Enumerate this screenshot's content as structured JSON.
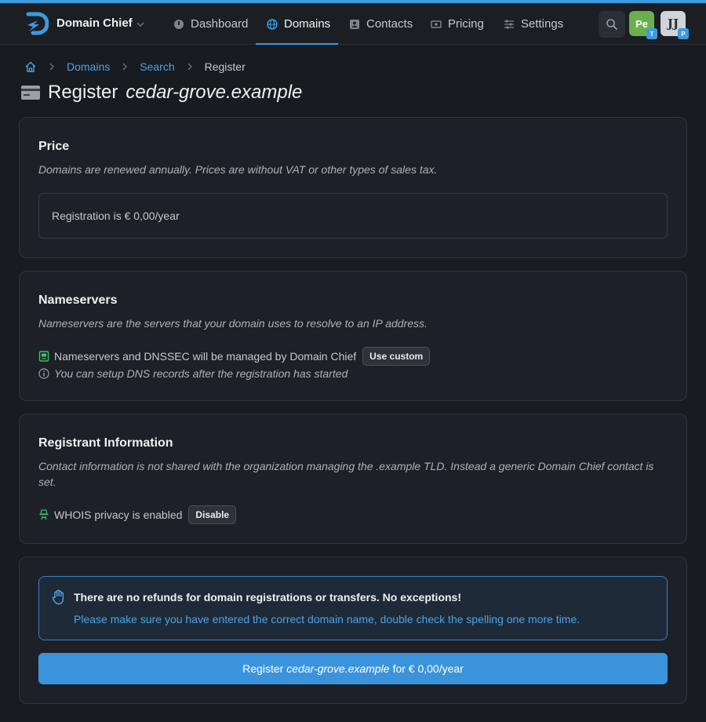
{
  "app": {
    "brand": "Domain Chief",
    "accent_color": "#3b9be0"
  },
  "nav": {
    "items": [
      {
        "label": "Dashboard",
        "icon": "dashboard-icon",
        "active": false
      },
      {
        "label": "Domains",
        "icon": "globe-icon",
        "active": true
      },
      {
        "label": "Contacts",
        "icon": "contact-card-icon",
        "active": false
      },
      {
        "label": "Pricing",
        "icon": "money-icon",
        "active": false
      },
      {
        "label": "Settings",
        "icon": "sliders-icon",
        "active": false
      }
    ],
    "avatars": [
      {
        "initials": "Pe",
        "badge": "T",
        "color": "#6ab04c"
      },
      {
        "initials": "JJ",
        "badge": "P",
        "color": "#d0d4d8"
      }
    ]
  },
  "breadcrumb": {
    "items": [
      "Domains",
      "Search"
    ],
    "current": "Register"
  },
  "page": {
    "title_prefix": "Register",
    "domain": "cedar-grove.example"
  },
  "price": {
    "title": "Price",
    "description": "Domains are renewed annually. Prices are without VAT or other types of sales tax.",
    "registration_text": "Registration is € 0,00/year"
  },
  "nameservers": {
    "title": "Nameservers",
    "description": "Nameservers are the servers that your domain uses to resolve to an IP address.",
    "managed_text": "Nameservers and DNSSEC will be managed by Domain Chief",
    "use_custom_label": "Use custom",
    "info_text": "You can setup DNS records after the registration has started"
  },
  "registrant": {
    "title": "Registrant Information",
    "description": "Contact information is not shared with the organization managing the .example TLD. Instead a generic Domain Chief contact is set.",
    "whois_text": "WHOIS privacy is enabled",
    "disable_label": "Disable"
  },
  "confirm": {
    "notice_title": "There are no refunds for domain registrations or transfers. No exceptions!",
    "notice_text": "Please make sure you have entered the correct domain name, double check the spelling one more time.",
    "button_prefix": "Register",
    "button_domain": "cedar-grove.example",
    "button_suffix": "for € 0,00/year"
  }
}
